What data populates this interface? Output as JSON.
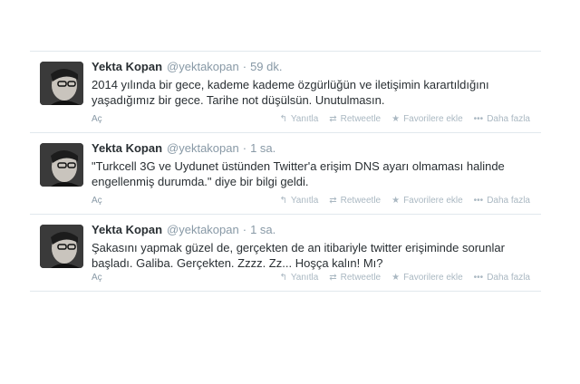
{
  "tweets": [
    {
      "fullname": "Yekta Kopan",
      "handle": "@yektakopan",
      "time": "59 dk.",
      "text_lines": [
        "2014 yılında bir gece, kademe kademe özgürlüğün ve iletişimin karartıldığını",
        "yaşadığımız bir gece. Tarihe not düşülsün. Unutulmasın."
      ],
      "expand": "Aç"
    },
    {
      "fullname": "Yekta Kopan",
      "handle": "@yektakopan",
      "time": "1 sa.",
      "text_lines": [
        "\"Turkcell 3G ve Uydunet üstünden Twitter'a erişim DNS ayarı olmaması halinde",
        "engellenmiş durumda.\" diye bir bilgi geldi."
      ],
      "expand": "Aç"
    },
    {
      "fullname": "Yekta Kopan",
      "handle": "@yektakopan",
      "time": "1 sa.",
      "text_lines": [
        "Şakasını yapmak güzel de, gerçekten de an itibariyle twitter erişiminde sorunlar",
        "başladı. Galiba. Gerçekten. Zzzz. Zz... Hoşça kalın! Mı?"
      ],
      "expand": "Aç"
    }
  ],
  "actions": {
    "reply": "Yanıtla",
    "retweet": "Retweetle",
    "favorite": "Favorilere ekle",
    "more": "Daha fazla"
  },
  "icons": {
    "reply": "reply-icon",
    "retweet": "retweet-icon",
    "favorite": "star-icon",
    "more": "ellipsis-icon"
  },
  "colors": {
    "name": "#292f33",
    "meta": "#8899a6",
    "action": "#aab8c2",
    "divider": "#e1e8ed"
  }
}
